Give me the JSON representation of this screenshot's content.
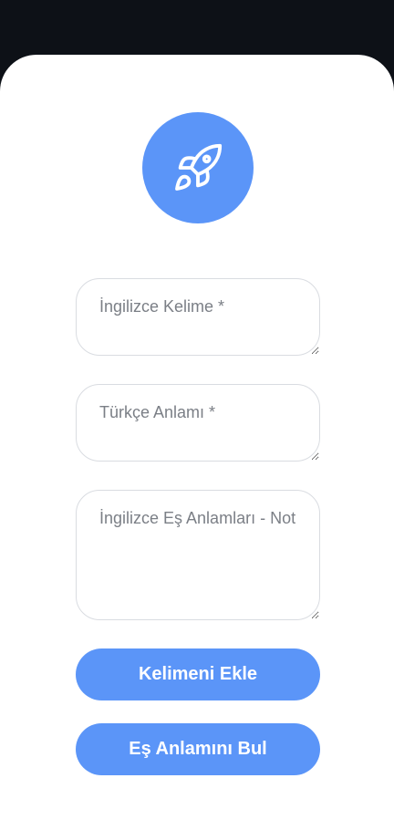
{
  "logo": {
    "icon": "rocket-icon",
    "color": "#5b95f8"
  },
  "form": {
    "english_word": {
      "placeholder": "İngilizce Kelime *",
      "value": ""
    },
    "turkish_meaning": {
      "placeholder": "Türkçe Anlamı *",
      "value": ""
    },
    "synonyms_note": {
      "placeholder": "İngilizce Eş Anlamları - Not",
      "value": ""
    }
  },
  "buttons": {
    "add_word": "Kelimeni Ekle",
    "find_synonym": "Eş Anlamını Bul"
  },
  "colors": {
    "accent": "#5b95f8",
    "top_bar": "#0d1117",
    "card": "#ffffff"
  }
}
